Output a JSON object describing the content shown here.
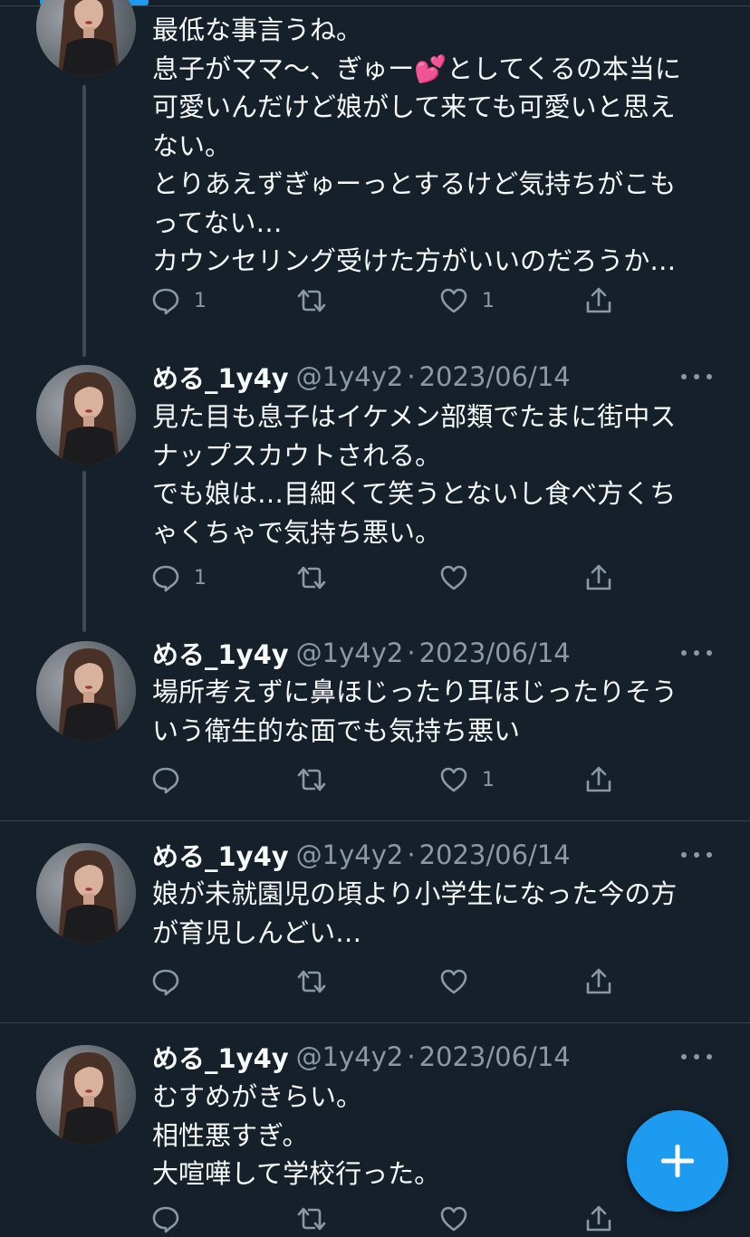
{
  "tweets": [
    {
      "lines": [
        "最低な事言うね。",
        "息子がママ〜、ぎゅー💕としてくるの本当に",
        "可愛いんだけど娘がして来ても可愛いと思え",
        "ない。",
        "とりあえずぎゅーっとするけど気持ちがこも",
        "ってない…",
        "カウンセリング受けた方がいいのだろうか…"
      ],
      "replies": "1",
      "retweets": "",
      "likes": "1"
    },
    {
      "name": "める_1y4y",
      "handle": "@1y4y2",
      "sep": "·",
      "date": "2023/06/14",
      "lines": [
        "見た目も息子はイケメン部類でたまに街中ス",
        "ナップスカウトされる。",
        "でも娘は…目細くて笑うとないし食べ方くち",
        "ゃくちゃで気持ち悪い。"
      ],
      "replies": "1",
      "retweets": "",
      "likes": ""
    },
    {
      "name": "める_1y4y",
      "handle": "@1y4y2",
      "sep": "·",
      "date": "2023/06/14",
      "lines": [
        "場所考えずに鼻ほじったり耳ほじったりそう",
        "いう衛生的な面でも気持ち悪い"
      ],
      "replies": "",
      "retweets": "",
      "likes": "1"
    },
    {
      "name": "める_1y4y",
      "handle": "@1y4y2",
      "sep": "·",
      "date": "2023/06/14",
      "lines": [
        "娘が未就園児の頃より小学生になった今の方",
        "が育児しんどい…"
      ],
      "replies": "",
      "retweets": "",
      "likes": ""
    },
    {
      "name": "める_1y4y",
      "handle": "@1y4y2",
      "sep": "·",
      "date": "2023/06/14",
      "lines": [
        "むすめがきらい。",
        "相性悪すぎ。",
        "大喧嘩して学校行った。"
      ],
      "replies": "",
      "retweets": "",
      "likes": ""
    }
  ],
  "icons": {
    "reply": "reply-icon",
    "retweet": "retweet-icon",
    "like": "heart-icon",
    "share": "share-icon",
    "more": "more-icon",
    "compose": "plus-icon"
  },
  "colors": {
    "background": "#15202b",
    "accent": "#1d9bf0",
    "muted": "#8b98a5"
  }
}
